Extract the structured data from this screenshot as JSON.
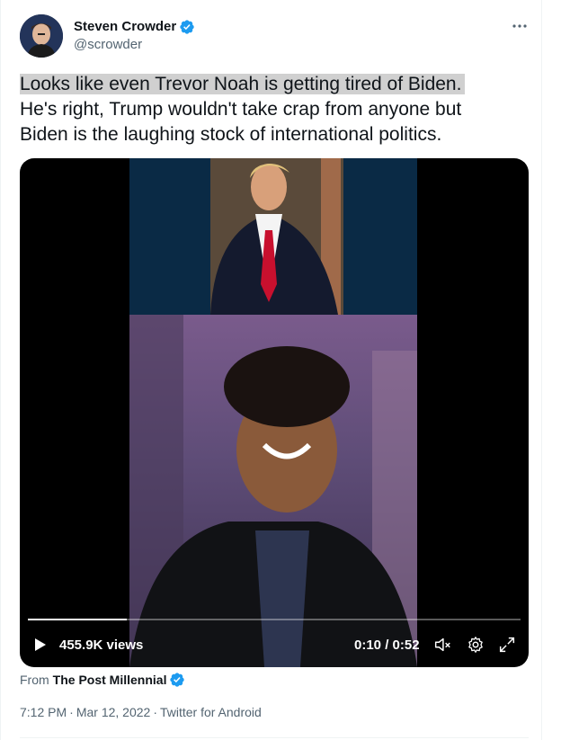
{
  "author": {
    "display_name": "Steven Crowder",
    "handle": "@scrowder",
    "verified": true
  },
  "tweet": {
    "line_highlight": "Looks like even Trevor Noah is getting tired of Biden.",
    "body": "He's right, Trump wouldn't take crap from anyone but\nBiden is the laughing stock of international politics."
  },
  "video": {
    "views": "455.9K views",
    "time": "0:10 / 0:52",
    "progress": 0.2
  },
  "source": {
    "prefix": "From",
    "name": "The Post Millennial",
    "verified": true
  },
  "meta": {
    "time": "7:12 PM",
    "date": "Mar 12, 2022",
    "client": "Twitter for Android",
    "separator": "·"
  },
  "icons": {
    "more": "more-options-icon",
    "verified": "verified-badge-icon",
    "play": "play-icon",
    "mute": "muted-speaker-icon",
    "settings": "gear-icon",
    "fullscreen": "fullscreen-icon"
  },
  "colors": {
    "verified_blue": "#1d9bf0",
    "text_primary": "#0f1419",
    "text_secondary": "#536471"
  }
}
